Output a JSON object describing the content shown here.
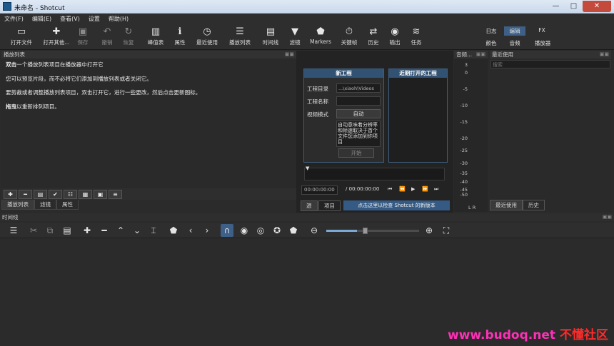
{
  "window": {
    "title": "未命名 - Shotcut",
    "minimize": "—",
    "maximize": "□",
    "close": "✕"
  },
  "menubar": [
    "文件(F)",
    "编辑(E)",
    "查看(V)",
    "设置",
    "帮助(H)"
  ],
  "toolbar": {
    "items": [
      {
        "label": "打开文件",
        "icon": "open-file-icon"
      },
      {
        "label": "打开其他...",
        "icon": "open-other-icon"
      },
      {
        "label": "保存",
        "icon": "save-icon"
      },
      {
        "label": "撤销",
        "icon": "undo-icon"
      },
      {
        "label": "恢复",
        "icon": "redo-icon"
      },
      {
        "label": "峰值表",
        "icon": "peak-meter-icon"
      },
      {
        "label": "属性",
        "icon": "properties-icon"
      },
      {
        "label": "最近使用",
        "icon": "recent-icon"
      },
      {
        "label": "播放列表",
        "icon": "playlist-icon"
      },
      {
        "label": "时间线",
        "icon": "timeline-icon"
      },
      {
        "label": "滤镜",
        "icon": "filter-icon"
      },
      {
        "label": "Markers",
        "icon": "markers-icon"
      },
      {
        "label": "关键帧",
        "icon": "keyframes-icon"
      },
      {
        "label": "历史",
        "icon": "history-icon"
      },
      {
        "label": "输出",
        "icon": "export-icon"
      },
      {
        "label": "任务",
        "icon": "jobs-icon"
      }
    ],
    "layouts_top": [
      "日志",
      "编辑",
      "FX"
    ],
    "layouts_bottom": [
      "颜色",
      "音频",
      "播放器"
    ]
  },
  "playlist": {
    "title": "播放列表",
    "help": [
      {
        "bold": "双击",
        "text": "一个播放列表项目在播放器中打开它"
      },
      {
        "bold": "",
        "text": "您可以预览片段，而不必将它们添加到播放列表或者关闭它。"
      },
      {
        "bold": "",
        "text": "要剪裁或者调整播放列表项目，双击打开它，进行一些更改，然后点击更新图标。"
      },
      {
        "bold": "拖曳",
        "text": "以重新排列项目。"
      }
    ],
    "tabs": [
      "播放列表",
      "滤镜",
      "属性"
    ]
  },
  "new_project": {
    "title": "新工程",
    "dir_label": "工程目录",
    "dir_value": "...\\xiaoh\\Videos",
    "name_label": "工程名称",
    "name_value": "",
    "mode_label": "视频模式",
    "mode_value": "自动",
    "desc": "自动意味着分辨率和帧速取决于首个文件您添加到你项目",
    "start": "开始"
  },
  "recent_projects": {
    "title": "近期打开的工程"
  },
  "transport": {
    "position": "00:00:00:00",
    "duration": "/ 00:00:00:00"
  },
  "source_tabs": {
    "source": "源",
    "project": "项目",
    "update_notice": "点击这里以检查 Shotcut 的新版本"
  },
  "meters": {
    "title": "音频...",
    "ticks": [
      "3",
      "0",
      "-5",
      "-10",
      "-15",
      "-20",
      "-25",
      "-30",
      "-35",
      "-40",
      "-45",
      "-50"
    ],
    "channels": "L  R"
  },
  "recent": {
    "title": "最近使用",
    "search_placeholder": "搜索",
    "tabs": [
      "最近使用",
      "历史"
    ]
  },
  "timeline": {
    "title": "时间线",
    "zoom_level": 0.33
  },
  "watermark": {
    "site": "www.budoq.net",
    "brand": "不懂社区"
  },
  "colors": {
    "accent": "#3d5f88",
    "panel_header": "#325273",
    "watermark": "#ff2fb6"
  }
}
